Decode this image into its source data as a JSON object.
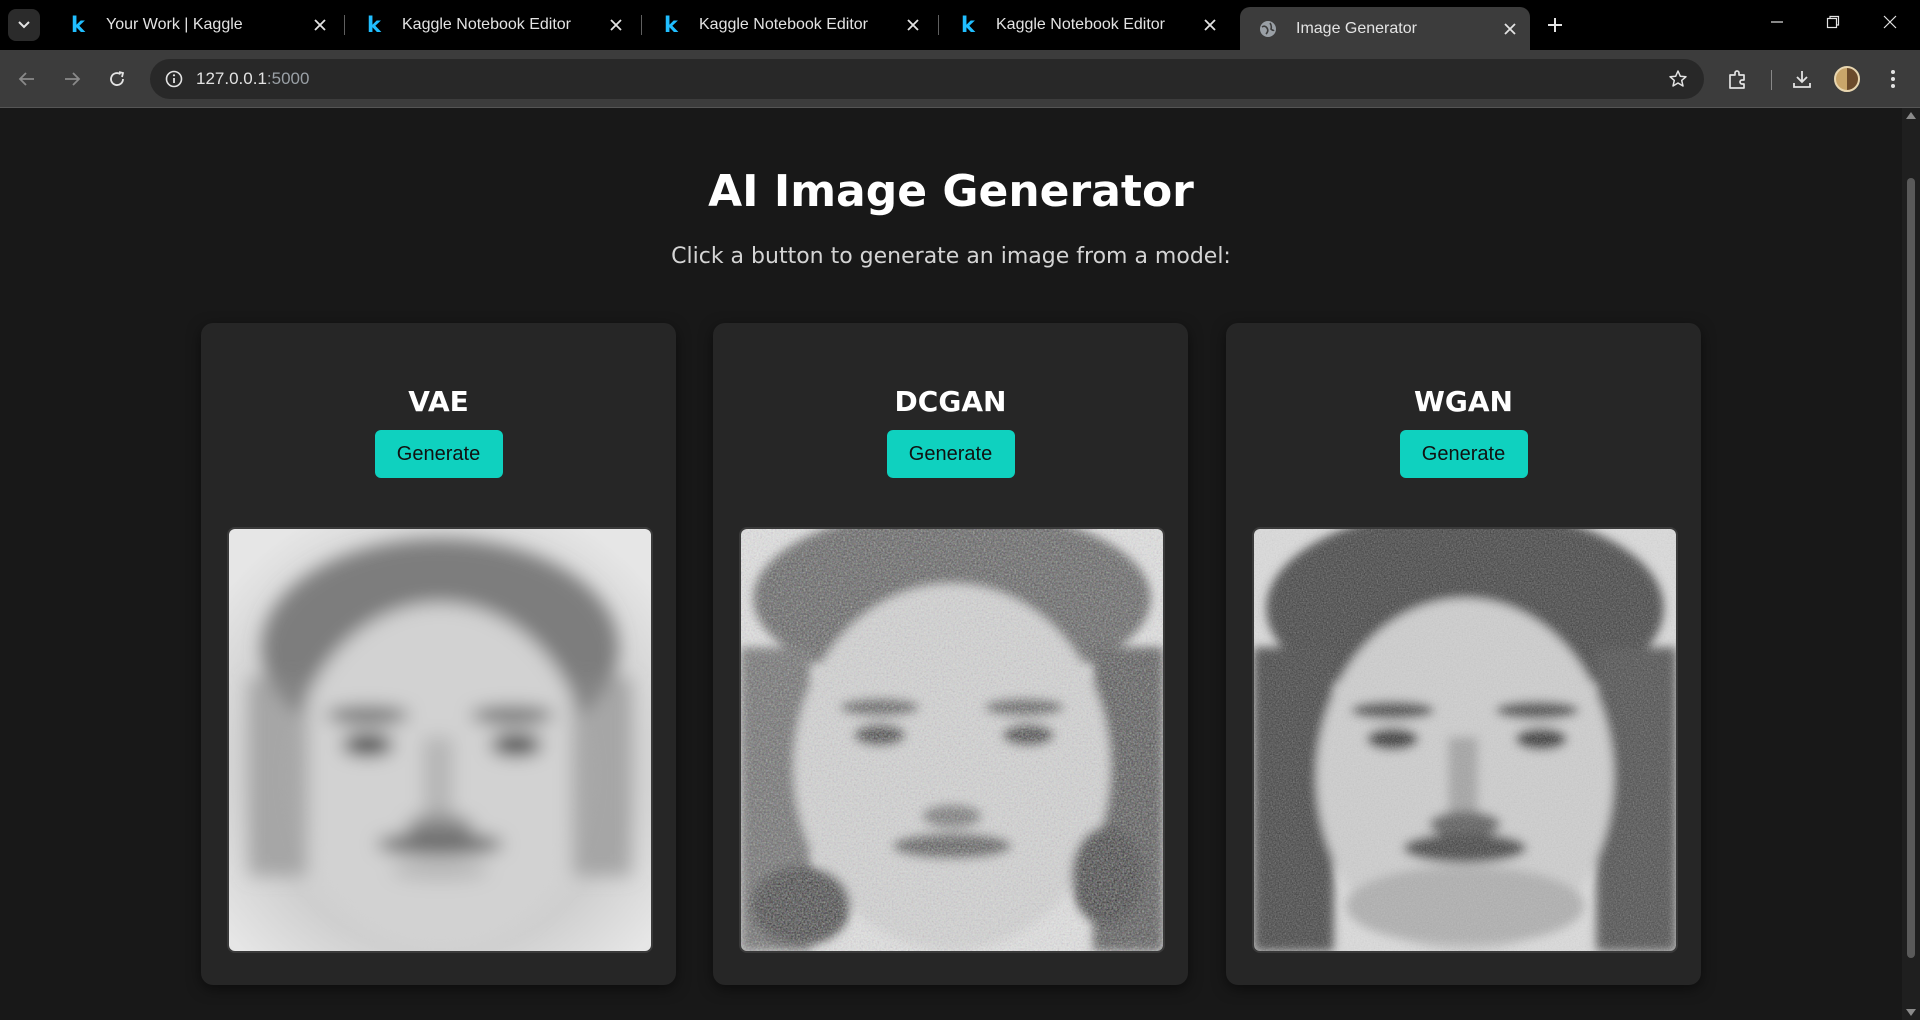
{
  "browser": {
    "tabs": [
      {
        "title": "Your Work | Kaggle",
        "icon": "kaggle-icon",
        "active": false
      },
      {
        "title": "Kaggle Notebook Editor",
        "icon": "kaggle-icon",
        "active": false
      },
      {
        "title": "Kaggle Notebook Editor",
        "icon": "kaggle-icon",
        "active": false
      },
      {
        "title": "Kaggle Notebook Editor",
        "icon": "kaggle-icon",
        "active": false
      },
      {
        "title": "Image Generator",
        "icon": "globe-icon",
        "active": true
      }
    ],
    "kaggle_letter": "k",
    "url_host": "127.0.0.1",
    "url_port": ":5000"
  },
  "page": {
    "title": "AI Image Generator",
    "subtitle": "Click a button to generate an image from a model:",
    "cards": [
      {
        "model": "VAE",
        "button": "Generate",
        "image": "blurry-grayscale-face"
      },
      {
        "model": "DCGAN",
        "button": "Generate",
        "image": "noisy-grayscale-face"
      },
      {
        "model": "WGAN",
        "button": "Generate",
        "image": "grayscale-face"
      }
    ]
  },
  "colors": {
    "accent": "#0fd1bf",
    "page_bg": "#181818",
    "card_bg": "#262626",
    "kaggle_blue": "#20beff"
  }
}
